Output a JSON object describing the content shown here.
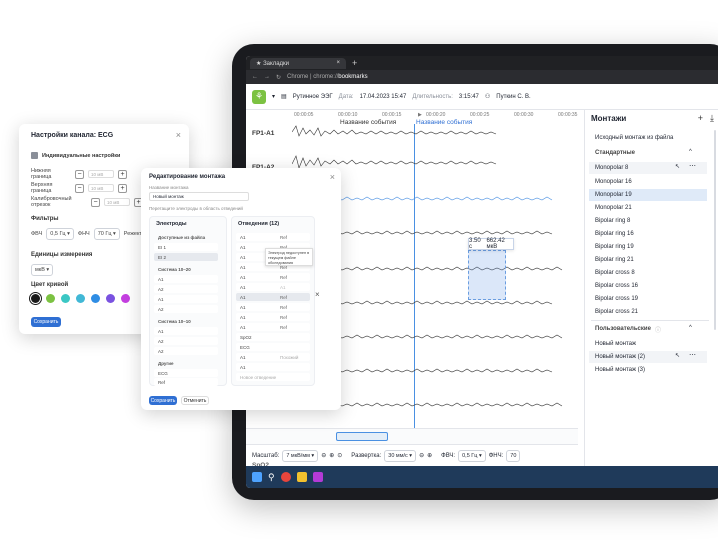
{
  "browser": {
    "tab_title": "Закладки",
    "url_prefix": "Chrome | chrome://",
    "url_path": "bookmarks"
  },
  "header": {
    "study_name": "Рутинное ЭЭГ",
    "date_label": "Дата:",
    "date_value": "17.04.2023 15:47",
    "duration_label": "Длительность:",
    "duration_value": "3:15:47",
    "patient": "Путкин С. В."
  },
  "timeline": {
    "ticks": [
      "00:00:05",
      "00:00:10",
      "00:00:15",
      "00:00:20",
      "00:00:25",
      "00:00:30",
      "00:00:35"
    ],
    "event1": "Название события",
    "event2": "Название события"
  },
  "channels": [
    "FP1-A1",
    "FP1-A2"
  ],
  "tooltip": {
    "time": "3.50 с",
    "value": "662.42 мкВ"
  },
  "controls": {
    "scale_label": "Масштаб:",
    "scale_value": "7 мкВ/мм",
    "sweep_label": "Развертка:",
    "sweep_value": "30 мм/с",
    "hpf_label": "ФВЧ:",
    "hpf_value": "0,5 Гц",
    "lpf_label": "ФНЧ:",
    "lpf_value": "70"
  },
  "montages": {
    "title": "Монтажи",
    "source_item": "Исходный монтаж из файла",
    "standard_header": "Стандартные",
    "standard": [
      "Monopolar 8",
      "Monopolar 16",
      "Monopolar 19",
      "Monopolar 21",
      "Bipolar ring 8",
      "Bipolar ring 16",
      "Bipolar ring 19",
      "Bipolar ring 21",
      "Bipolar cross 8",
      "Bipolar cross 16",
      "Bipolar cross 19",
      "Bipolar cross 21"
    ],
    "user_header": "Пользовательские",
    "user": [
      "Новый монтаж",
      "Новый монтаж (2)",
      "Новый монтаж (3)"
    ]
  },
  "channel_settings": {
    "title": "Настройки канала: ECG",
    "individual": "Индивидуальные настройки",
    "lower": "Нижняя граница",
    "lower_val": "10 мВ",
    "upper": "Верхняя граница",
    "upper_val": "10 мВ",
    "calib": "Калибровочный отрезок",
    "calib_val": "10 мВ",
    "filters": "Фильтры",
    "hpf": "ФВЧ",
    "hpf_val": "0,5 Гц",
    "lpf": "ФНЧ",
    "lpf_val": "70 Гц",
    "notch": "Режекто",
    "units": "Единицы измерения",
    "units_val": "мкВ",
    "color": "Цвет кривой",
    "save": "Сохранить",
    "swatches": [
      "#1a1a1a",
      "#7cc242",
      "#3bc7c4",
      "#41b8d6",
      "#2f8de4",
      "#7a52e0",
      "#c43fe0"
    ]
  },
  "montage_editor": {
    "title": "Редактирование монтажа",
    "name_label": "Название монтажа",
    "name_value": "Новый монтаж",
    "hint": "Перетащите электроды в область отведений",
    "electrodes": "Электроды",
    "leads": "Отведения (12)",
    "groups": [
      {
        "name": "Доступные из файла",
        "items": [
          "EI 1",
          "EI 2"
        ]
      },
      {
        "name": "Система 10–20",
        "items": [
          "A1",
          "A2",
          "A1",
          "A2"
        ]
      },
      {
        "name": "Система 10–10",
        "items": [
          "A1",
          "A2",
          "A2"
        ]
      },
      {
        "name": "Другие",
        "items": [
          "ECG",
          "Ref"
        ]
      }
    ],
    "lead_rows": [
      {
        "a": "A1",
        "b": "Ref"
      },
      {
        "a": "A1",
        "b": "Ref"
      },
      {
        "a": "A1",
        "b": "Ref"
      },
      {
        "a": "A1",
        "b": "Ref"
      },
      {
        "a": "A1",
        "b": "Ref"
      },
      {
        "a": "A1",
        "b": "A1"
      },
      {
        "a": "A1",
        "b": "Ref"
      },
      {
        "a": "A1",
        "b": "Ref"
      },
      {
        "a": "A1",
        "b": "Ref"
      },
      {
        "a": "A1",
        "b": "Ref"
      },
      {
        "a": "SpO2",
        "b": ""
      },
      {
        "a": "ECG",
        "b": ""
      },
      {
        "a": "A1",
        "b": "Похожий"
      },
      {
        "a": "A1",
        "b": ""
      },
      {
        "a": "Новое отведение",
        "b": ""
      }
    ],
    "tooltip": "Электрод недоступен в текущем файле обследования",
    "save": "Сохранить",
    "cancel": "Отменить"
  },
  "bottom_channel": "SpO2"
}
